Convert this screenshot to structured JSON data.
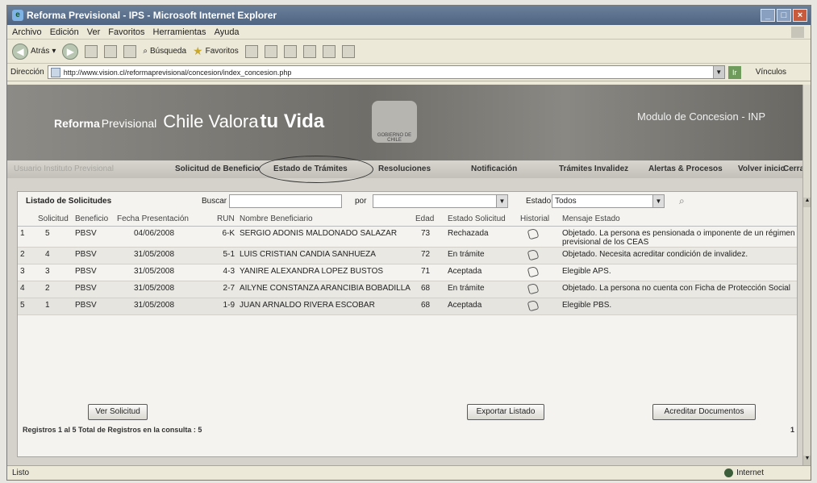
{
  "window": {
    "title": "Reforma Previsional - IPS - Microsoft Internet Explorer",
    "controls": [
      "_",
      "□",
      "×"
    ]
  },
  "menu": [
    "Archivo",
    "Edición",
    "Ver",
    "Favoritos",
    "Herramientas",
    "Ayuda"
  ],
  "toolbar": {
    "back": "Atrás",
    "search": "Búsqueda",
    "favorites": "Favoritos"
  },
  "address": {
    "label": "Dirección",
    "url": "http://www.vision.cl/reformaprevisional/concesion/index_concesion.php",
    "go": "Ir",
    "links": "Vínculos"
  },
  "banner": {
    "ref_bold": "Reforma",
    "ref_light": "Previsional",
    "slogan_a": "Chile Valora",
    "slogan_b": "tu Vida",
    "seal_text": "GOBIERNO DE CHILE",
    "module": "Modulo de Concesion - INP"
  },
  "nav": {
    "faded": "Usuario Instituto Previsional",
    "items": [
      "Solicitud de Beneficio",
      "Estado de Trámites",
      "Resoluciones",
      "Notificación",
      "Trámites Invalidez",
      "Alertas & Procesos",
      "Volver inicio",
      "Cerrar"
    ]
  },
  "list": {
    "title": "Listado de Solicitudes",
    "buscar_label": "Buscar",
    "buscar_value": "",
    "por_label": "por",
    "por_value": "",
    "estado_label": "Estado",
    "estado_value": "Todos",
    "columns": [
      "",
      "Solicitud",
      "Beneficio",
      "Fecha Presentación",
      "RUN",
      "Nombre Beneficiario",
      "Edad",
      "Estado Solicitud",
      "Historial",
      "Mensaje Estado"
    ],
    "rows": [
      {
        "n": "1",
        "solicitud": "5",
        "beneficio": "PBSV",
        "fecha": "04/06/2008",
        "run": "6-K",
        "nombre": "SERGIO ADONIS MALDONADO SALAZAR",
        "edad": "73",
        "estado": "Rechazada",
        "mensaje": "Objetado. La persona es pensionada o imponente de un régimen previsional de los CEAS"
      },
      {
        "n": "2",
        "solicitud": "4",
        "beneficio": "PBSV",
        "fecha": "31/05/2008",
        "run": "5-1",
        "nombre": "LUIS CRISTIAN CANDIA SANHUEZA",
        "edad": "72",
        "estado": "En trámite",
        "mensaje": "Objetado. Necesita acreditar condición de invalidez."
      },
      {
        "n": "3",
        "solicitud": "3",
        "beneficio": "PBSV",
        "fecha": "31/05/2008",
        "run": "4-3",
        "nombre": "YANIRE ALEXANDRA LOPEZ BUSTOS",
        "edad": "71",
        "estado": "Aceptada",
        "mensaje": "Elegible APS."
      },
      {
        "n": "4",
        "solicitud": "2",
        "beneficio": "PBSV",
        "fecha": "31/05/2008",
        "run": "2-7",
        "nombre": "AILYNE CONSTANZA ARANCIBIA BOBADILLA",
        "edad": "68",
        "estado": "En trámite",
        "mensaje": "Objetado. La persona no cuenta con Ficha de Protección Social"
      },
      {
        "n": "5",
        "solicitud": "1",
        "beneficio": "PBSV",
        "fecha": "31/05/2008",
        "run": "1-9",
        "nombre": "JUAN ARNALDO RIVERA ESCOBAR",
        "edad": "68",
        "estado": "Aceptada",
        "mensaje": "Elegible PBS."
      }
    ],
    "footer": "Registros 1 al 5   Total de Registros en la consulta : 5",
    "page": "1"
  },
  "buttons": {
    "ver": "Ver Solicitud",
    "exportar": "Exportar Listado",
    "acreditar": "Acreditar Documentos"
  },
  "status": {
    "left": "Listo",
    "zone": "Internet"
  }
}
